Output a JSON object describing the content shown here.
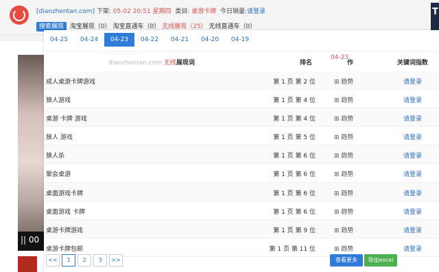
{
  "header": {
    "domain_link": "[dianzhentan.com]",
    "shelf_label": "下架:",
    "shelf_time": "05-02 20:51 星期四",
    "category_label": "类目:",
    "category_value": "桌游卡牌",
    "sales_label": "今日销量:",
    "sales_value": "请登录",
    "search_tag": "搜索展现",
    "taobao_show": "淘宝展现（0）",
    "taobao_train": "淘宝直通车（0）",
    "wireless_show": "无线展现（25）",
    "wireless_train": "无线直通车（0）"
  },
  "dates": [
    "04-25",
    "04-24",
    "04-23",
    "04-22",
    "04-21",
    "04-20",
    "04-19"
  ],
  "active_date_index": 2,
  "table": {
    "watermark": "dianzhentan.com",
    "wireless_label": "无线",
    "col_keyword": "展现词",
    "col_rank": "排名",
    "col_date": "04-23",
    "col_op": "作",
    "col_index": "关键词指数",
    "rows": [
      {
        "keyword": "成人桌游卡牌游戏",
        "rank": "第 1 页 第 2 位",
        "trend": "⊞ 趋势",
        "index": "请登录"
      },
      {
        "keyword": "狼人游戏",
        "rank": "第 1 页 第 4 位",
        "trend": "⊞ 趋势",
        "index": "请登录"
      },
      {
        "keyword": "桌游 卡牌 游戏",
        "rank": "第 1 页 第 4 位",
        "trend": "⊞ 趋势",
        "index": "请登录"
      },
      {
        "keyword": "狼人 游戏",
        "rank": "第 1 页 第 5 位",
        "trend": "⊞ 趋势",
        "index": "请登录"
      },
      {
        "keyword": "狼人杀",
        "rank": "第 1 页 第 6 位",
        "trend": "⊞ 趋势",
        "index": "请登录"
      },
      {
        "keyword": "聚会桌游",
        "rank": "第 1 页 第 6 位",
        "trend": "⊞ 趋势",
        "index": "请登录"
      },
      {
        "keyword": "桌面游戏卡牌",
        "rank": "第 1 页 第 6 位",
        "trend": "⊞ 趋势",
        "index": "请登录"
      },
      {
        "keyword": "桌面游戏 卡牌",
        "rank": "第 1 页 第 6 位",
        "trend": "⊞ 趋势",
        "index": "请登录"
      },
      {
        "keyword": "桌游卡牌游戏",
        "rank": "第 1 页 第 9 位",
        "trend": "⊞ 趋势",
        "index": "请登录"
      },
      {
        "keyword": "桌游卡牌包邮",
        "rank": "第 1 页 第 11 位",
        "trend": "⊞ 趋势",
        "index": "请登录"
      }
    ]
  },
  "pager": {
    "prev": "<<",
    "pages": [
      "1",
      "2",
      "3"
    ],
    "next": ">>"
  },
  "buttons": {
    "more": "查看更多",
    "excel": "导出excel"
  },
  "video": {
    "pause": "||  00"
  },
  "colors": {
    "accent": "#2f7bd7",
    "red": "#d9534f",
    "green": "#4caf50"
  }
}
